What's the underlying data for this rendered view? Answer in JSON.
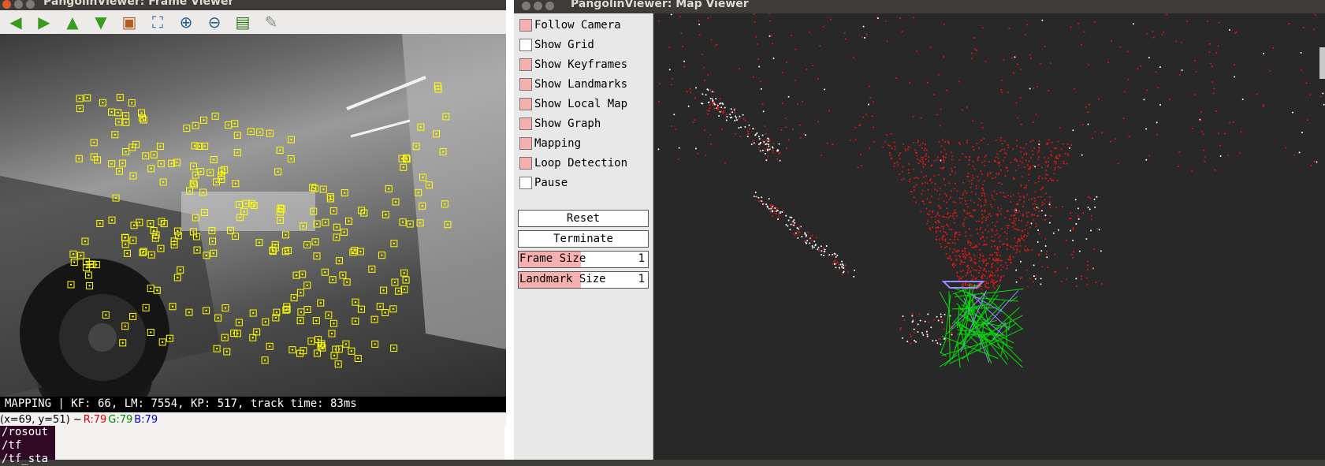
{
  "frame_viewer": {
    "title": "PangolinViewer: Frame Viewer",
    "toolbar": [
      {
        "icon": "arrow-left-icon",
        "glyph": "◀",
        "color": "#3a9b20"
      },
      {
        "icon": "arrow-right-icon",
        "glyph": "▶",
        "color": "#3a9b20"
      },
      {
        "icon": "arrow-up-icon",
        "glyph": "▲",
        "color": "#3a9b20"
      },
      {
        "icon": "arrow-down-icon",
        "glyph": "▼",
        "color": "#3a9b20"
      },
      {
        "icon": "image-icon",
        "glyph": "▣",
        "color": "#b55a20"
      },
      {
        "icon": "zoom-fit-icon",
        "glyph": "⛶",
        "color": "#2c5f8a"
      },
      {
        "icon": "zoom-in-icon",
        "glyph": "⊕",
        "color": "#2c5f8a"
      },
      {
        "icon": "zoom-out-icon",
        "glyph": "⊖",
        "color": "#2c5f8a"
      },
      {
        "icon": "save-icon",
        "glyph": "▤",
        "color": "#2f7a1e"
      },
      {
        "icon": "brush-icon",
        "glyph": "✎",
        "color": "#8a8a8a"
      }
    ],
    "status": "MAPPING | KF: 66, LM: 7554, KP: 517, track time: 83ms",
    "pixel_info": {
      "coords": "(x=69, y=51) ~",
      "r": "R:79",
      "g": "G:79",
      "b": "B:79"
    },
    "feature_color": "#ffff00"
  },
  "terminal": {
    "lines": [
      "/rosout",
      "/tf",
      "/tf_sta"
    ]
  },
  "map_viewer": {
    "title": "PangolinViewer: Map Viewer",
    "checkboxes": [
      {
        "label": "Follow Camera",
        "checked": true
      },
      {
        "label": "Show Grid",
        "checked": false
      },
      {
        "label": "Show Keyframes",
        "checked": true
      },
      {
        "label": "Show Landmarks",
        "checked": true
      },
      {
        "label": "Show Local Map",
        "checked": true
      },
      {
        "label": "Show Graph",
        "checked": true
      },
      {
        "label": "Mapping",
        "checked": true
      },
      {
        "label": "Loop Detection",
        "checked": true
      },
      {
        "label": "Pause",
        "checked": false
      }
    ],
    "buttons": [
      "Reset",
      "Terminate"
    ],
    "variables": [
      {
        "label": "Frame Size",
        "value": "1",
        "level": 0.48
      },
      {
        "label": "Landmark Size",
        "value": "1",
        "level": 0.48
      }
    ],
    "colors": {
      "landmark": "#e01818",
      "local_map": "#ffffff",
      "keyframe": "#00e000",
      "current": "#9090ff",
      "checked": "#f7b0b0"
    }
  }
}
